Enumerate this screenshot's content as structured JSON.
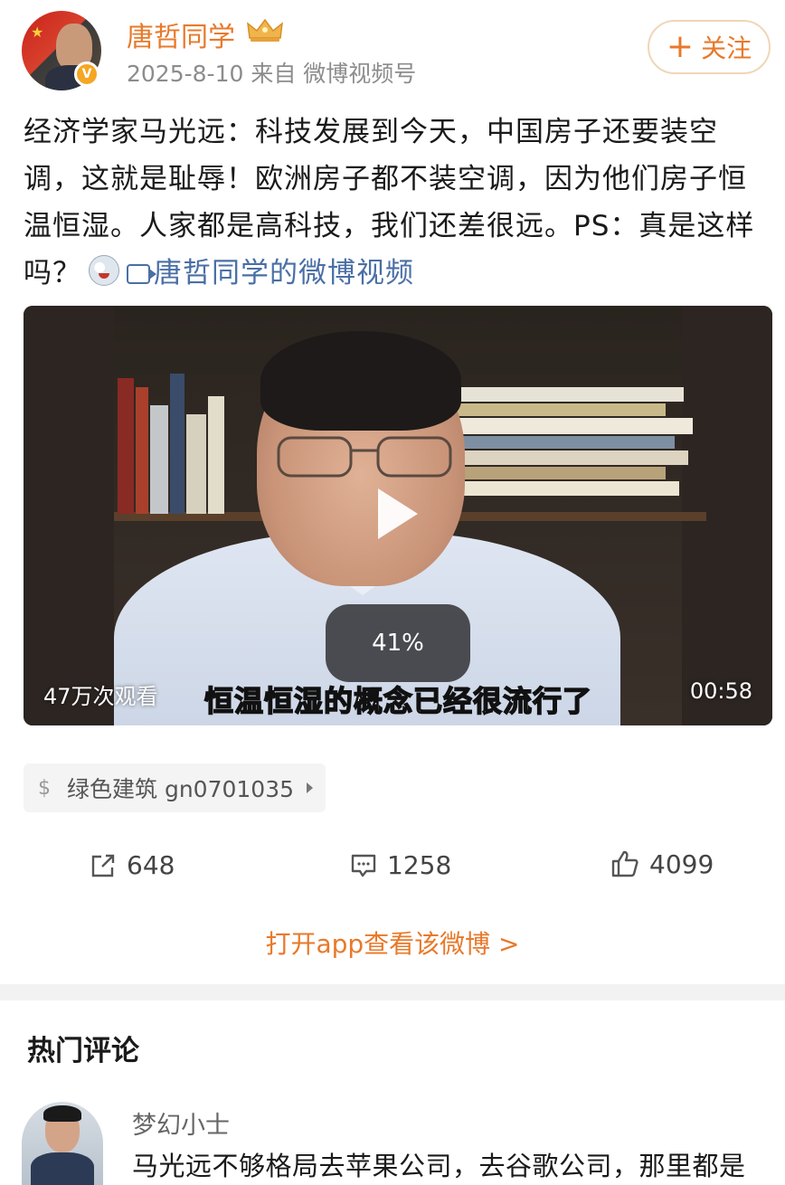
{
  "post": {
    "author": "唐哲同学",
    "date": "2025-8-10",
    "source": "来自 微博视频号",
    "follow_label": "关注",
    "text": "经济学家马光远：科技发展到今天，中国房子还要装空调，这就是耻辱！欧洲房子都不装空调，因为他们房子恒温恒湿。人家都是高科技，我们还差很远。PS：真是这样吗？",
    "video_link": "唐哲同学的微博视频"
  },
  "video": {
    "progress": "41%",
    "views": "47万次观看",
    "duration": "00:58",
    "subtitle": "恒温恒湿的概念已经很流行了"
  },
  "tag": {
    "label": "绿色建筑 gn0701035"
  },
  "actions": {
    "reposts": "648",
    "comments": "1258",
    "likes": "4099"
  },
  "open_app": "打开app查看该微博 >",
  "comments_section": {
    "title": "热门评论",
    "items": [
      {
        "user": "梦幻小士",
        "text": "马光远不够格局去苹果公司，去谷歌公司，那里都是"
      }
    ]
  },
  "colors": {
    "accent": "#e8792a",
    "link": "#4a6fa5"
  }
}
